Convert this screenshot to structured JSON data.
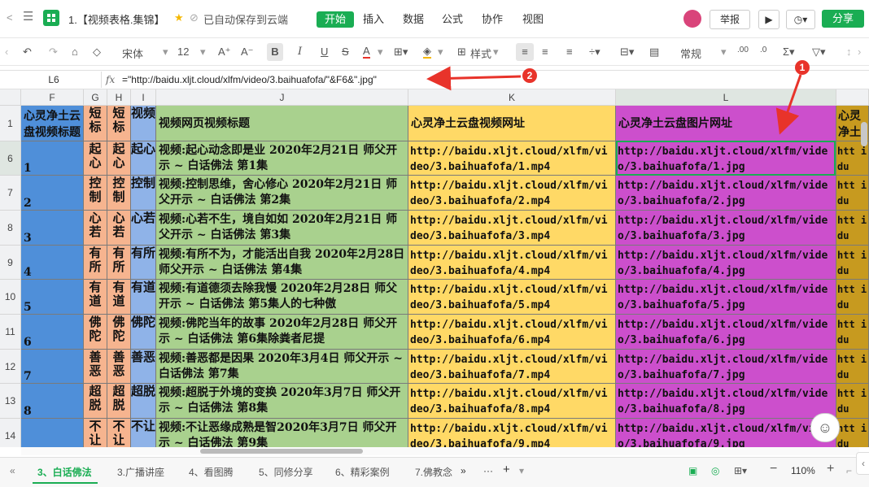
{
  "titlebar": {
    "doc_title": "1.【视频表格.集锦】",
    "save_status": "已自动保存到云端",
    "menus": [
      "开始",
      "插入",
      "数据",
      "公式",
      "协作",
      "视图"
    ],
    "report": "举报",
    "share": "分享"
  },
  "toolbar": {
    "font_name": "宋体",
    "font_size": "12",
    "style_label": "样式",
    "number_format": "常规"
  },
  "formulabar": {
    "cell_ref": "L6",
    "fx": "fx",
    "formula": "=\"http://baidu.xljt.cloud/xlfm/video/3.baihuafofa/\"&F6&\".jpg\""
  },
  "columns": [
    "F",
    "G",
    "H",
    "I",
    "J",
    "K",
    "L"
  ],
  "header_row": {
    "num": "1",
    "f": "心灵净土云盘视频标题",
    "g": "短标",
    "h": "短标",
    "i": "视频",
    "j": "视频网页视频标题",
    "k": "心灵净土云盘视频网址",
    "l": "心灵净土云盘图片网址",
    "m": "心灵净土云盘"
  },
  "rows": [
    {
      "num": "6",
      "f": "1",
      "g": "起心",
      "h": "起心",
      "i": "起心",
      "j": "视频:起心动念即是业 2020年2月21日 师父开示 ~ 白话佛法 第1集",
      "k": "http://baidu.xljt.cloud/xlfm/video/3.baihuafofa/1.mp4",
      "l": "http://baidu.xljt.cloud/xlfm/video/3.baihuafofa/1.jpg",
      "m": "htt idu"
    },
    {
      "num": "7",
      "f": "2",
      "g": "控制",
      "h": "控制",
      "i": "控制",
      "j": "视频:控制思维，舍心修心 2020年2月21日 师父开示 ~ 白话佛法 第2集",
      "k": "http://baidu.xljt.cloud/xlfm/video/3.baihuafofa/2.mp4",
      "l": "http://baidu.xljt.cloud/xlfm/video/3.baihuafofa/2.jpg",
      "m": "htt idu"
    },
    {
      "num": "8",
      "f": "3",
      "g": "心若",
      "h": "心若",
      "i": "心若",
      "j": "视频:心若不生，境自如如 2020年2月21日 师父开示 ~ 白话佛法 第3集",
      "k": "http://baidu.xljt.cloud/xlfm/video/3.baihuafofa/3.mp4",
      "l": "http://baidu.xljt.cloud/xlfm/video/3.baihuafofa/3.jpg",
      "m": "htt idu"
    },
    {
      "num": "9",
      "f": "4",
      "g": "有所",
      "h": "有所",
      "i": "有所",
      "j": "视频:有所不为，才能活出自我 2020年2月28日 师父开示 ~ 白话佛法 第4集",
      "k": "http://baidu.xljt.cloud/xlfm/video/3.baihuafofa/4.mp4",
      "l": "http://baidu.xljt.cloud/xlfm/video/3.baihuafofa/4.jpg",
      "m": "htt idu"
    },
    {
      "num": "10",
      "f": "5",
      "g": "有道",
      "h": "有道",
      "i": "有道",
      "j": "视频:有道德须去除我慢 2020年2月28日 师父开示 ~ 白话佛法 第5集人的七种傲",
      "k": "http://baidu.xljt.cloud/xlfm/video/3.baihuafofa/5.mp4",
      "l": "http://baidu.xljt.cloud/xlfm/video/3.baihuafofa/5.jpg",
      "m": "htt idu"
    },
    {
      "num": "11",
      "f": "6",
      "g": "佛陀",
      "h": "佛陀",
      "i": "佛陀",
      "j": "视频:佛陀当年的故事 2020年2月28日 师父开示 ~ 白话佛法 第6集除粪者尼提",
      "k": "http://baidu.xljt.cloud/xlfm/video/3.baihuafofa/6.mp4",
      "l": "http://baidu.xljt.cloud/xlfm/video/3.baihuafofa/6.jpg",
      "m": "htt idu"
    },
    {
      "num": "12",
      "f": "7",
      "g": "善恶",
      "h": "善恶",
      "i": "善恶",
      "j": "视频:善恶都是因果 2020年3月4日 师父开示 ~ 白话佛法 第7集",
      "k": "http://baidu.xljt.cloud/xlfm/video/3.baihuafofa/7.mp4",
      "l": "http://baidu.xljt.cloud/xlfm/video/3.baihuafofa/7.jpg",
      "m": "htt idu"
    },
    {
      "num": "13",
      "f": "8",
      "g": "超脱",
      "h": "超脱",
      "i": "超脱",
      "j": "视频:超脱于外境的变换 2020年3月7日 师父开示 ~ 白话佛法 第8集",
      "k": "http://baidu.xljt.cloud/xlfm/video/3.baihuafofa/8.mp4",
      "l": "http://baidu.xljt.cloud/xlfm/video/3.baihuafofa/8.jpg",
      "m": "htt idu"
    },
    {
      "num": "14",
      "f": "",
      "g": "不让",
      "h": "不让",
      "i": "不让",
      "j": "视频:不让恶缘成熟是智2020年3月7日 师父开示 ~ 白话佛法 第9集",
      "k": "http://baidu.xljt.cloud/xlfm/video/3.baihuafofa/9.mp4",
      "l": "http://baidu.xljt.cloud/xlfm/video/3.baihuafofa/9.jpg",
      "m": "htt idu"
    }
  ],
  "sheet_tabs": [
    "3、白话佛法",
    "3.广播讲座",
    "4、看图腾",
    "5、同修分享",
    "6、精彩案例",
    "7.佛教念"
  ],
  "statusbar": {
    "zoom": "110%"
  },
  "annotations": {
    "badge1": "1",
    "badge2": "2"
  }
}
